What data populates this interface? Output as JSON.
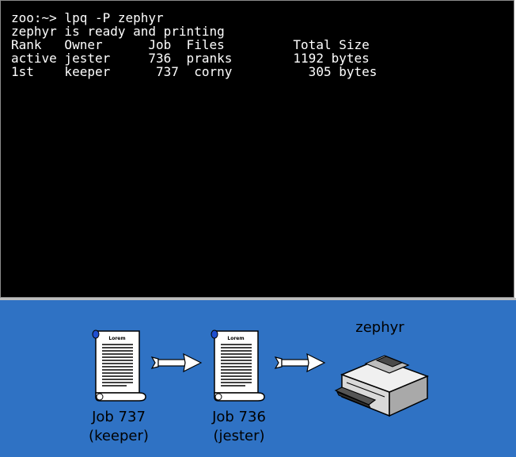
{
  "terminal": {
    "lines": [
      "zoo:~> lpq -P zephyr",
      "zephyr is ready and printing",
      "Rank   Owner      Job  Files         Total Size",
      "active jester     736  pranks        1192 bytes",
      "1st    keeper      737  corny          305 bytes"
    ]
  },
  "queue": {
    "jobs": [
      {
        "doc_label": "Lorem",
        "caption_line1": "Job 737",
        "caption_line2": "(keeper)"
      },
      {
        "doc_label": "Lorem",
        "caption_line1": "Job 736",
        "caption_line2": "(jester)"
      }
    ],
    "printer_name": "zephyr"
  },
  "colors": {
    "terminal_bg": "#000000",
    "terminal_fg": "#ffffff",
    "panel_bg": "#2f72c4"
  },
  "icons": [
    "document-icon",
    "arrow-right-icon",
    "printer-icon"
  ]
}
